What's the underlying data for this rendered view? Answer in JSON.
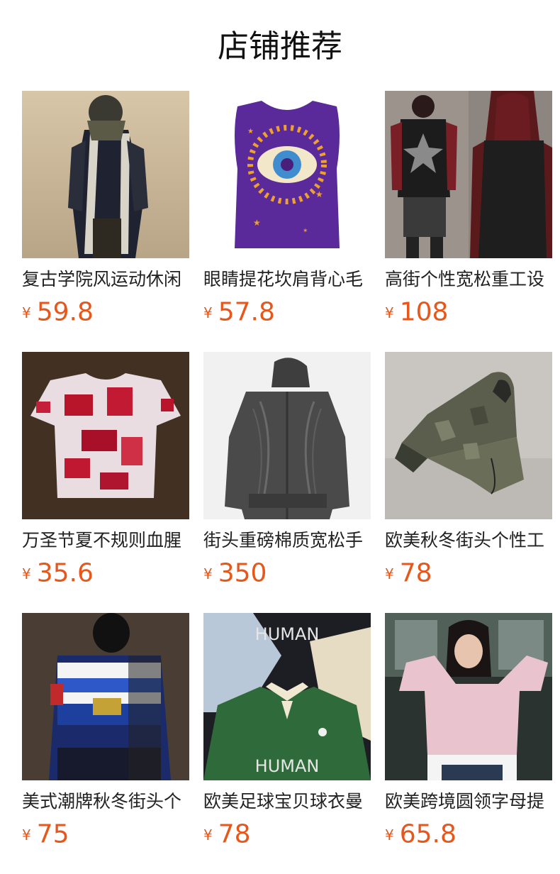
{
  "header": {
    "title": "店铺推荐"
  },
  "currency_symbol": "¥",
  "products": [
    {
      "name": "复古学院风运动休闲",
      "price": "59.8",
      "image_icon": "moto-jacket-photo"
    },
    {
      "name": "眼睛提花坎肩背心毛",
      "price": "57.8",
      "image_icon": "eye-vest-photo"
    },
    {
      "name": "高街个性宽松重工设",
      "price": "108",
      "image_icon": "hoodie-outfit-photo"
    },
    {
      "name": "万圣节夏不规则血腥",
      "price": "35.6",
      "image_icon": "tie-dye-tshirt-photo"
    },
    {
      "name": "街头重磅棉质宽松手",
      "price": "350",
      "image_icon": "grey-hoodie-photo"
    },
    {
      "name": "欧美秋冬街头个性工",
      "price": "78",
      "image_icon": "camo-jacket-photo"
    },
    {
      "name": "美式潮牌秋冬街头个",
      "price": "75",
      "image_icon": "blue-moto-jacket-photo"
    },
    {
      "name": "欧美足球宝贝球衣曼",
      "price": "78",
      "image_icon": "football-jersey-photo"
    },
    {
      "name": "欧美跨境圆领字母提",
      "price": "65.8",
      "image_icon": "pink-sweater-photo"
    }
  ],
  "jersey_text": "HUMAN"
}
